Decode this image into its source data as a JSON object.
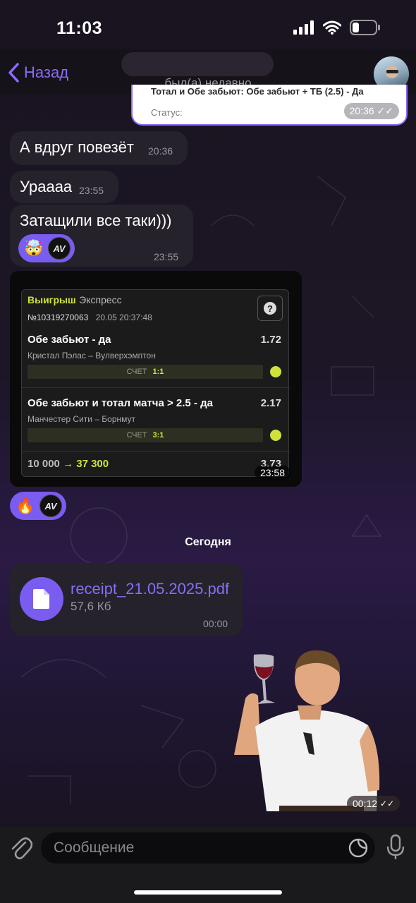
{
  "status_bar": {
    "time": "11:03"
  },
  "header": {
    "back_label": "Назад",
    "subtitle": "был(а) недавно"
  },
  "top_bubble": {
    "line": "Тотал и Обе забьют: Обе забьют + ТБ (2.5) - Да",
    "status_label": "Статус:",
    "time": "20:36"
  },
  "messages": [
    {
      "text": "А вдруг повезёт",
      "time": "20:36"
    },
    {
      "text": "Урaaaa",
      "time": "23:55"
    },
    {
      "text": "Затащили все таки)))",
      "time": "23:55"
    }
  ],
  "reaction1": {
    "emoji": "🤯",
    "badge": "AV"
  },
  "bet_slip": {
    "win_label": "Выигрыш",
    "type_label": "Экспресс",
    "number": "№10319270063",
    "date": "20.05 20:37:48",
    "help_icon_char": "?",
    "picks": [
      {
        "title": "Обе забьют - да",
        "teams": "Кристал Пэлас – Вулверхэмптон",
        "odd": "1.72",
        "score_label": "СЧЕТ",
        "score": "1:1"
      },
      {
        "title": "Обе забьют и тотал матча > 2.5 - да",
        "teams": "Манчестер Сити – Борнмут",
        "odd": "2.17",
        "score_label": "СЧЕТ",
        "score": "3:1"
      }
    ],
    "stake": "10 000",
    "arrow": "→",
    "payout": "37 300",
    "total_odd": "3.73",
    "time": "23:58"
  },
  "reaction2": {
    "emoji": "🔥",
    "badge": "AV"
  },
  "date_divider": "Сегодня",
  "file": {
    "name": "receipt_21.05.2025.pdf",
    "size": "57,6 Кб",
    "time": "00:00"
  },
  "sticker": {
    "time": "00:12"
  },
  "composer": {
    "placeholder": "Сообщение"
  },
  "colors": {
    "accent": "#8b6cf6",
    "bubble": "#25222b",
    "reaction": "#7b5cf0",
    "bet_highlight": "#cfe23a"
  }
}
